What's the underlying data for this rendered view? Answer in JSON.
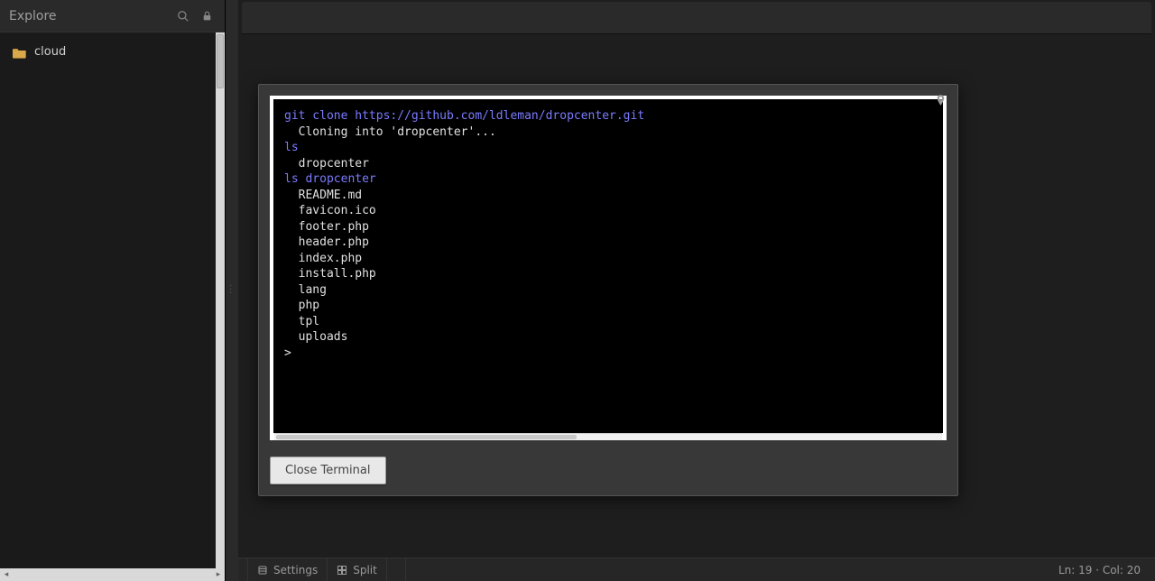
{
  "sidebar": {
    "title": "Explore",
    "items": [
      {
        "label": "cloud"
      }
    ]
  },
  "terminal": {
    "lines": [
      {
        "type": "cmd",
        "text": "git clone https://github.com/ldleman/dropcenter.git"
      },
      {
        "type": "out",
        "text": "  Cloning into 'dropcenter'..."
      },
      {
        "type": "cmd",
        "text": "ls"
      },
      {
        "type": "out",
        "text": "  dropcenter"
      },
      {
        "type": "cmd",
        "text": "ls dropcenter"
      },
      {
        "type": "out",
        "text": "  README.md"
      },
      {
        "type": "out",
        "text": "  favicon.ico"
      },
      {
        "type": "out",
        "text": "  footer.php"
      },
      {
        "type": "out",
        "text": "  header.php"
      },
      {
        "type": "out",
        "text": "  index.php"
      },
      {
        "type": "out",
        "text": "  install.php"
      },
      {
        "type": "out",
        "text": "  lang"
      },
      {
        "type": "out",
        "text": "  php"
      },
      {
        "type": "out",
        "text": "  tpl"
      },
      {
        "type": "out",
        "text": "  uploads"
      },
      {
        "type": "prompt",
        "text": ">"
      }
    ],
    "close_label": "Close Terminal"
  },
  "statusbar": {
    "settings_label": "Settings",
    "split_label": "Split",
    "cursor": {
      "line": 19,
      "col": 20
    },
    "cursor_format": "Ln: {line} · Col: {col}"
  }
}
